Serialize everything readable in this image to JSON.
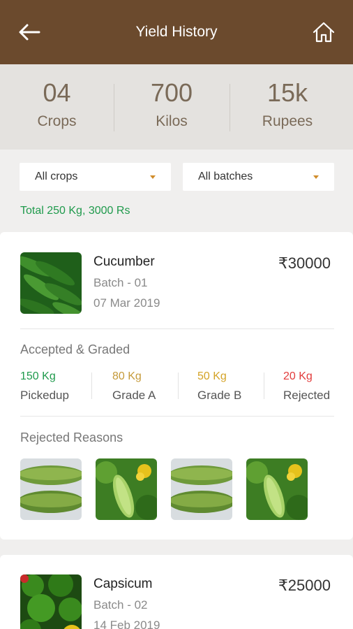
{
  "header": {
    "title": "Yield History",
    "back_icon": "back-arrow-icon",
    "home_icon": "home-icon"
  },
  "summary": [
    {
      "value": "04",
      "label": "Crops"
    },
    {
      "value": "700",
      "label": "Kilos"
    },
    {
      "value": "15k",
      "label": "Rupees"
    }
  ],
  "filters": {
    "crop": "All crops",
    "batch": "All batches"
  },
  "total": "Total 250 Kg, 3000 Rs",
  "cards": [
    {
      "name": "Cucumber",
      "batch": "Batch - 01",
      "date": "07 Mar 2019",
      "price": "₹30000",
      "section_title": "Accepted & Graded",
      "grades": [
        {
          "value": "150 Kg",
          "label": "Pickedup",
          "color": "#1f9a4c"
        },
        {
          "value": "80 Kg",
          "label": "Grade A",
          "color": "#c59a3a"
        },
        {
          "value": "50 Kg",
          "label": "Grade B",
          "color": "#d4a327"
        },
        {
          "value": "20 Kg",
          "label": "Rejected",
          "color": "#e23b3b"
        }
      ],
      "rejected_title": "Rejected Reasons"
    },
    {
      "name": "Capsicum",
      "batch": "Batch - 02",
      "date": "14 Feb 2019",
      "price": "₹25000"
    }
  ]
}
